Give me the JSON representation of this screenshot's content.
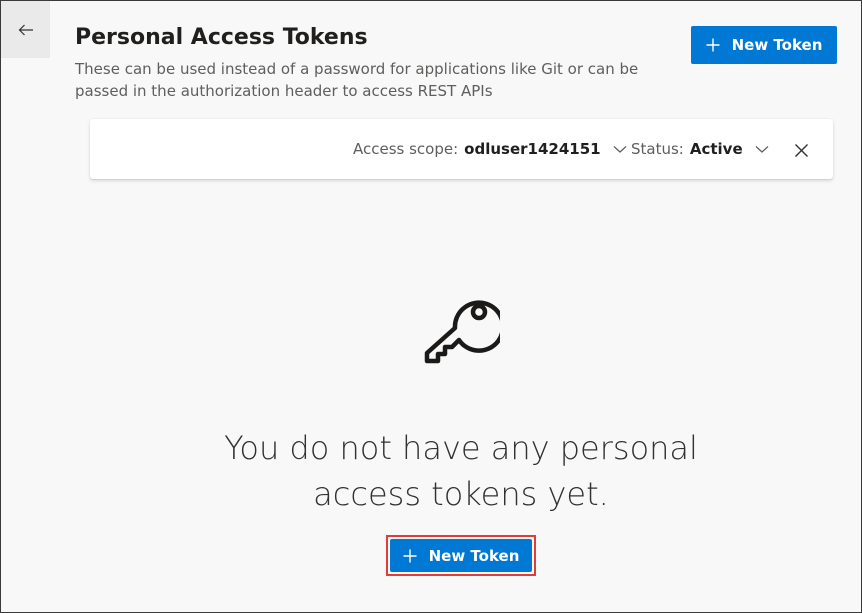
{
  "header": {
    "title": "Personal Access Tokens",
    "subtitle": "These can be used instead of a password for applications like Git or can be passed in the authorization header to access REST APIs",
    "new_token_label": "New Token"
  },
  "filters": {
    "scope_label": "Access scope:",
    "scope_value": "odluser1424151",
    "status_label": "Status:",
    "status_value": "Active"
  },
  "empty_state": {
    "message": "You do not have any personal access tokens yet.",
    "new_token_label": "New Token"
  },
  "icons": [
    "back-arrow-icon",
    "plus-icon",
    "chevron-down-icon",
    "close-icon",
    "key-icon"
  ],
  "colors": {
    "primary": "#0078d4",
    "highlight": "#e03c3c"
  }
}
